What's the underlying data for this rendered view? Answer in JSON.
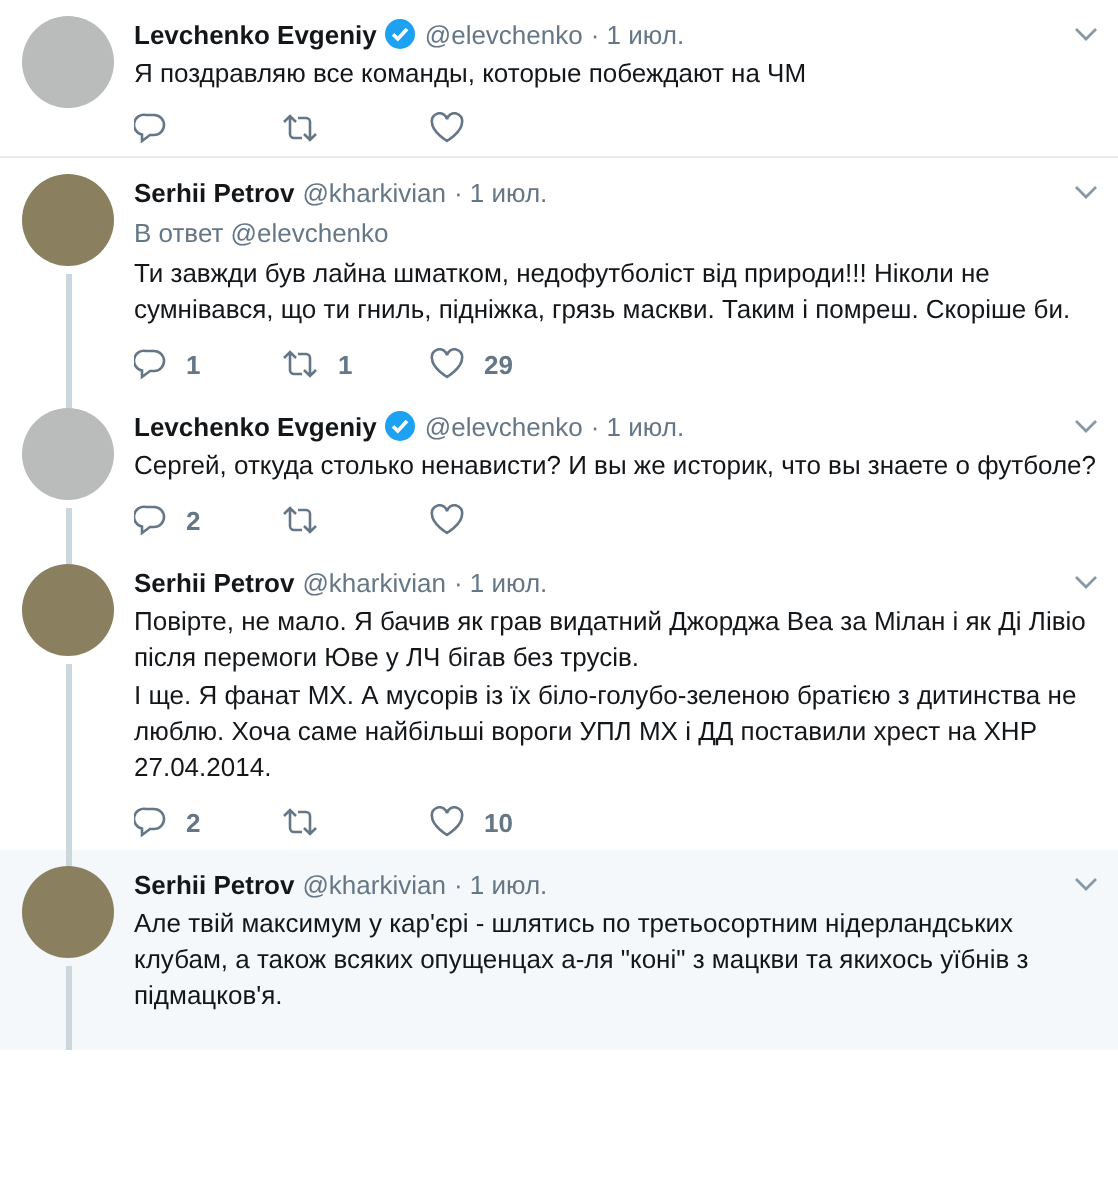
{
  "tweets": [
    {
      "author": "Levchenko Evgeniy",
      "verified": true,
      "handle": "@elevchenko",
      "date": "· 1 июл.",
      "line_above": false,
      "line_below": false,
      "highlighted": false,
      "paragraphs": [
        "Я поздравляю все команды, которые побеждают на ЧМ"
      ],
      "actions": [
        {
          "kind": "reply"
        },
        {
          "kind": "retweet"
        },
        {
          "kind": "like"
        }
      ]
    },
    {
      "author": "Serhii Petrov",
      "verified": false,
      "handle": "@kharkivian",
      "date": "· 1 июл.",
      "line_above": false,
      "line_below": true,
      "highlighted": false,
      "reply_to": "В ответ @elevchenko",
      "paragraphs": [
        "Ти завжди був лайна шматком, недофутболіст від природи!!! Ніколи не сумнівався, що ти гниль, підніжка, грязь маскви. Таким і помреш. Скоріше би."
      ],
      "actions": [
        {
          "kind": "reply",
          "count": "1"
        },
        {
          "kind": "retweet",
          "count": "1"
        },
        {
          "kind": "like",
          "count": "29"
        }
      ]
    },
    {
      "author": "Levchenko Evgeniy",
      "verified": true,
      "handle": "@elevchenko",
      "date": "· 1 июл.",
      "line_above": true,
      "line_below": true,
      "highlighted": false,
      "paragraphs": [
        "Сергей, откуда столько ненависти? И вы же историк, что вы знаете о футболе?"
      ],
      "actions": [
        {
          "kind": "reply",
          "count": "2"
        },
        {
          "kind": "retweet"
        },
        {
          "kind": "like"
        }
      ]
    },
    {
      "author": "Serhii Petrov",
      "verified": false,
      "handle": "@kharkivian",
      "date": "· 1 июл.",
      "line_above": true,
      "line_below": true,
      "highlighted": false,
      "paragraphs": [
        "Повірте, не мало.  Я бачив як грав видатний Джорджа Веа за Мілан і як Ді Лівіо після перемоги Юве у ЛЧ бігав без трусів.",
        "І ще. Я фанат МХ. А мусорів із їх біло-голубо-зеленою братією з дитинства не люблю. Хоча саме найбільші вороги УПЛ МХ і ДД поставили хрест на ХНР 27.04.2014."
      ],
      "actions": [
        {
          "kind": "reply",
          "count": "2"
        },
        {
          "kind": "retweet"
        },
        {
          "kind": "like",
          "count": "10"
        }
      ]
    },
    {
      "author": "Serhii Petrov",
      "verified": false,
      "handle": "@kharkivian",
      "date": "· 1 июл.",
      "line_above": true,
      "line_below": true,
      "highlighted": true,
      "paragraphs": [
        "Але твій максимум у кар'єрі - шлятись по третьосортним нідерландських клубам, а також всяких опущенцах а-ля \"коні\" з мацкви та якихось уїбнів з підмацков'я."
      ]
    }
  ]
}
